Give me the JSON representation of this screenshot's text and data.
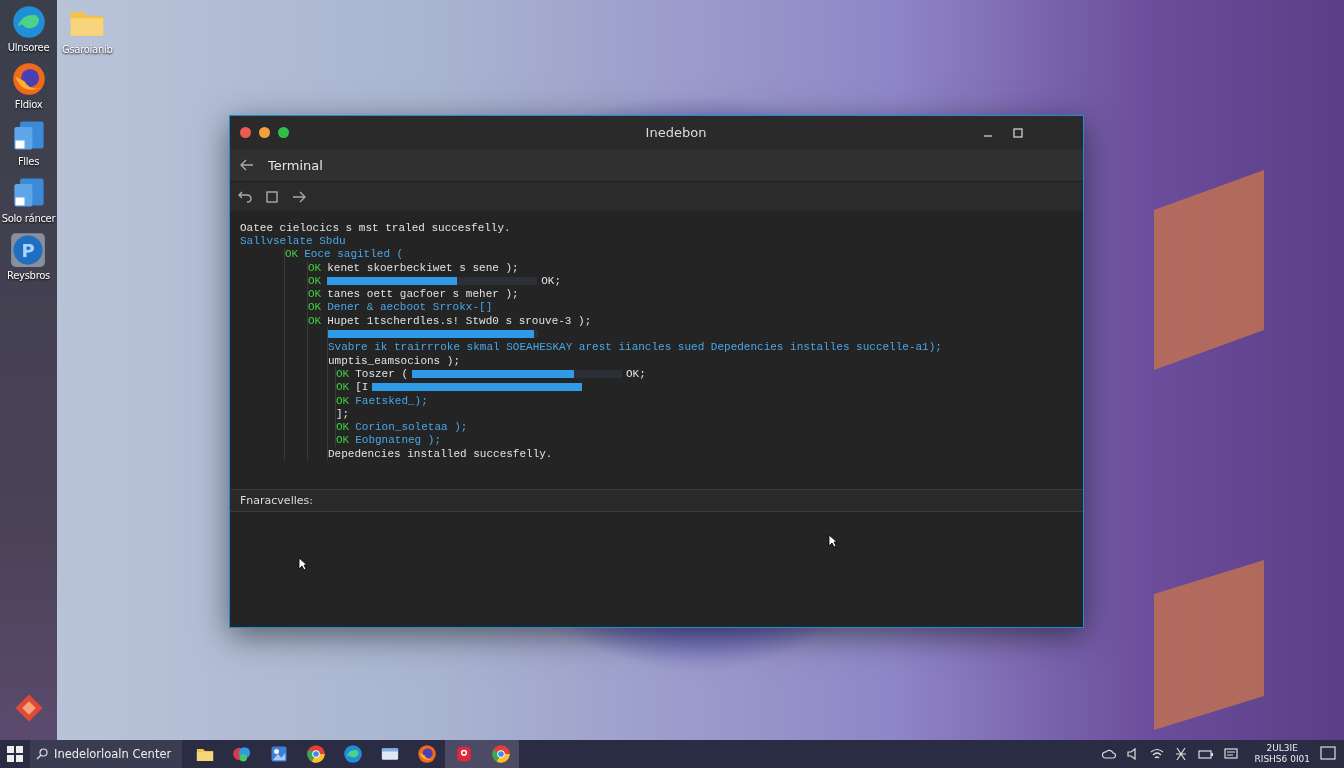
{
  "dock": {
    "items": [
      {
        "kind": "swirl",
        "label": "Ulnsoree"
      },
      {
        "kind": "orb",
        "label": "Fldiox"
      },
      {
        "kind": "tile",
        "label": "Flles"
      },
      {
        "kind": "tile",
        "label": "Solo ráncer"
      },
      {
        "kind": "letter",
        "glyph": "P",
        "label": "Reysbros"
      },
      {
        "kind": "diamond"
      }
    ]
  },
  "desktop_icons": [
    {
      "kind": "folder",
      "label": "Gsaroianib"
    }
  ],
  "window": {
    "title": "Inedebon",
    "header": "Terminal",
    "lines": [
      {
        "color": "#e2e2e2",
        "text": "Oatee cielocics s mst traled succesfelly."
      },
      {
        "color": "#49a6e8",
        "text": "Sallvselate Sbdu",
        "children": [
          {
            "status": "OK",
            "color": "#49a6e8",
            "text": "Eoce sagitled (",
            "children": [
              {
                "status": "OK",
                "color": "#e2e2e2",
                "text": "kenet skoerbeckiwet s sene );"
              },
              {
                "status": "OK",
                "level": 0.62,
                "suffix": "OK;"
              },
              {
                "status": "OK",
                "color": "#e2e2e2",
                "text": "tanes oett gacfoer s meher );"
              },
              {
                "status": "OK",
                "color": "#49a6e8",
                "text": "Dener & aecboot Srrokx-[]"
              },
              {
                "status": "OK",
                "color": "#e2e2e2",
                "text": "Hupet 1tscherdles.s! Stwd0 s srouve-3 );",
                "children": [
                  {
                    "level": 0.98
                  },
                  {
                    "color": "#49a6e8",
                    "text": "Svabre ik trairrroke skmal SOEAHESKAY arest iiancles sued Depedencies installes succelle-a1);"
                  },
                  {
                    "color": "#e2e2e2",
                    "text": "umptis_eamsocions );",
                    "children": [
                      {
                        "status": "OK",
                        "color": "#e2e2e2",
                        "text": "Toszer (",
                        "level": 0.77,
                        "suffix": "OK;"
                      },
                      {
                        "status": "OK",
                        "text": "[I",
                        "level": 1
                      },
                      {
                        "status": "OK",
                        "color": "#49a6e8",
                        "text": "Faetsked_);"
                      },
                      {
                        "text": "];"
                      },
                      {
                        "status": "OK",
                        "color": "#49a6e8",
                        "text": "Corion_soletaa );"
                      },
                      {
                        "status": "OK",
                        "color": "#49a6e8",
                        "text": "Eobgnatneg );"
                      }
                    ]
                  },
                  {
                    "color": "#e2e2e2",
                    "text": "Depedencies installed succesfelly."
                  }
                ]
              }
            ]
          }
        ]
      }
    ],
    "prompt": "Fnaracvelles:"
  },
  "taskbar": {
    "search": "Inedelorloaln Center",
    "apps": [
      {
        "kind": "folder",
        "selected": false
      },
      {
        "kind": "palette",
        "selected": false
      },
      {
        "kind": "picture",
        "selected": false
      },
      {
        "kind": "ring",
        "selected": false
      },
      {
        "kind": "swirl",
        "selected": false
      },
      {
        "kind": "window",
        "selected": false
      },
      {
        "kind": "orb",
        "selected": false
      },
      {
        "kind": "badge",
        "selected": true
      },
      {
        "kind": "ring",
        "selected": true
      }
    ],
    "clock": {
      "time": "2UL3IE",
      "date": "RISHS6 0I01"
    }
  }
}
